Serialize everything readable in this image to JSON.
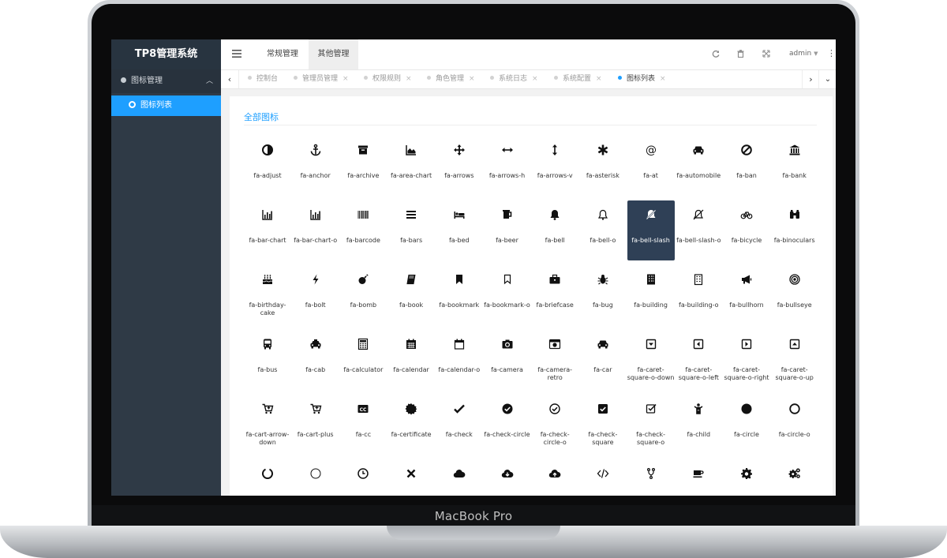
{
  "device": {
    "brand": "MacBook Pro"
  },
  "app": {
    "title": "TP8管理系统"
  },
  "sidebar": {
    "group": {
      "label": "图标管理",
      "icon": "circle-dot-icon",
      "expand_icon": "chevron-up-icon"
    },
    "items": [
      {
        "label": "图标列表",
        "icon": "ring-icon",
        "active": true
      }
    ]
  },
  "header": {
    "menu_icon": "hamburger-icon",
    "tabs": [
      {
        "label": "常规管理"
      },
      {
        "label": "其他管理",
        "active": true
      }
    ],
    "icons": [
      "refresh-icon",
      "trash-icon",
      "fullscreen-icon"
    ],
    "user": "admin",
    "more_icon": "vertical-dots-icon"
  },
  "tabs_bar": {
    "tabs": [
      {
        "label": "控制台"
      },
      {
        "label": "管理员管理"
      },
      {
        "label": "权限规则"
      },
      {
        "label": "角色管理"
      },
      {
        "label": "系统日志"
      },
      {
        "label": "系统配置"
      },
      {
        "label": "图标列表",
        "active": true
      }
    ],
    "close_glyph": "×"
  },
  "content": {
    "title": "全部图标",
    "selected": "fa-bell-slash",
    "icons": [
      "fa-adjust",
      "fa-anchor",
      "fa-archive",
      "fa-area-chart",
      "fa-arrows",
      "fa-arrows-h",
      "fa-arrows-v",
      "fa-asterisk",
      "fa-at",
      "fa-automobile",
      "fa-ban",
      "fa-bank",
      "fa-bar-chart",
      "fa-bar-chart-o",
      "fa-barcode",
      "fa-bars",
      "fa-bed",
      "fa-beer",
      "fa-bell",
      "fa-bell-o",
      "fa-bell-slash",
      "fa-bell-slash-o",
      "fa-bicycle",
      "fa-binoculars",
      "fa-birthday-cake",
      "fa-bolt",
      "fa-bomb",
      "fa-book",
      "fa-bookmark",
      "fa-bookmark-o",
      "fa-briefcase",
      "fa-bug",
      "fa-building",
      "fa-building-o",
      "fa-bullhorn",
      "fa-bullseye",
      "fa-bus",
      "fa-cab",
      "fa-calculator",
      "fa-calendar",
      "fa-calendar-o",
      "fa-camera",
      "fa-camera-retro",
      "fa-car",
      "fa-caret-square-o-down",
      "fa-caret-square-o-left",
      "fa-caret-square-o-right",
      "fa-caret-square-o-up",
      "fa-cart-arrow-down",
      "fa-cart-plus",
      "fa-cc",
      "fa-certificate",
      "fa-check",
      "fa-check-circle",
      "fa-check-circle-o",
      "fa-check-square",
      "fa-check-square-o",
      "fa-child",
      "fa-circle",
      "fa-circle-o",
      "fa-circle-o-notch",
      "fa-circle-thin",
      "fa-clock-o",
      "fa-close",
      "fa-cloud",
      "fa-cloud-download",
      "fa-cloud-upload",
      "fa-code",
      "fa-code-fork",
      "fa-coffee",
      "fa-cog",
      "fa-cogs"
    ]
  }
}
